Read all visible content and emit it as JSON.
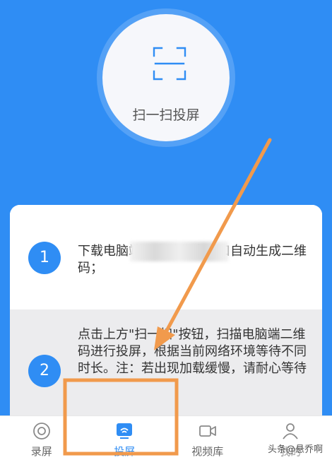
{
  "scan": {
    "label": "扫一扫投屏",
    "icon": "scan-icon"
  },
  "steps": [
    {
      "number": "1",
      "text": "下载电脑端，启动程序窗口自动生成二维码；"
    },
    {
      "number": "2",
      "text": "点击上方\"扫一扫\"按钮，扫描电脑端二维码进行投屏，根据当前网络环境等待不同时长。注：若出现加载缓慢，请耐心等待"
    }
  ],
  "nav": {
    "items": [
      {
        "label": "录屏",
        "icon": "record-icon",
        "active": false
      },
      {
        "label": "投屏",
        "icon": "cast-icon",
        "active": true
      },
      {
        "label": "视频库",
        "icon": "video-camera-icon",
        "active": false
      },
      {
        "label": "我的",
        "icon": "user-icon",
        "active": false
      }
    ]
  },
  "watermark": "头条@悬乔啊",
  "colors": {
    "primary": "#2f8df4",
    "annotation": "#f19a4c"
  }
}
